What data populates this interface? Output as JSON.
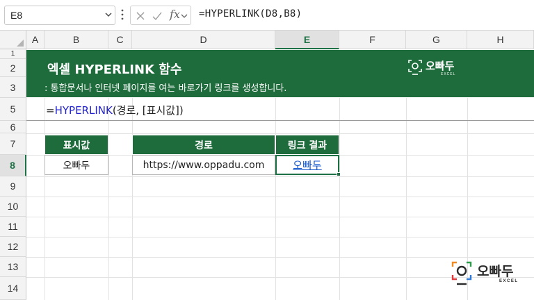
{
  "formula_bar": {
    "name_box": "E8",
    "fx_label": "fx",
    "formula": "=HYPERLINK(D8,B8)"
  },
  "columns": [
    "A",
    "B",
    "C",
    "D",
    "E",
    "F",
    "G",
    "H"
  ],
  "selected_column": "E",
  "rows": [
    "1",
    "2",
    "3",
    "5",
    "6",
    "7",
    "8",
    "9",
    "10",
    "11",
    "12",
    "13",
    "14"
  ],
  "selected_row": "8",
  "banner": {
    "title": "엑셀 HYPERLINK 함수",
    "subtitle": ": 통합문서나 인터넷 페이지를 여는 바로가기 링크를 생성합니다.",
    "logo_text": "오빠두",
    "logo_sub": "EXCEL"
  },
  "syntax": {
    "prefix": "=",
    "function_name": "HYPERLINK",
    "args": "(경로, [표시값])"
  },
  "table1": {
    "header": "표시값",
    "value": "오빠두"
  },
  "table2": {
    "headers": [
      "경로",
      "링크 결과"
    ],
    "path": "https://www.oppadu.com",
    "link_result": "오빠두"
  },
  "corner_logo": {
    "text": "오빠두",
    "sub": "EXCEL"
  },
  "colors": {
    "banner_green": "#1e6b3c",
    "link_blue": "#1155cc",
    "function_blue": "#2222cc",
    "selection_green": "#1e7145"
  }
}
